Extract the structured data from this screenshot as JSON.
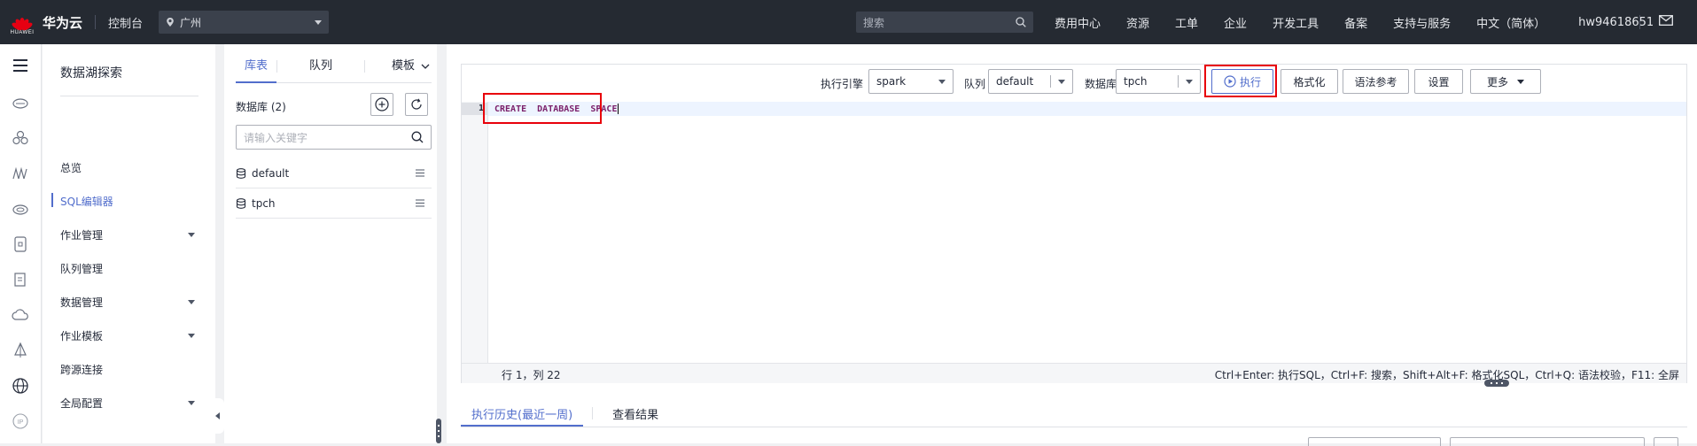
{
  "topbar": {
    "logo_text": "HUAWEI",
    "brand": "华为云",
    "console": "控制台",
    "region": "广州",
    "search_placeholder": "搜索",
    "nav": [
      "费用中心",
      "资源",
      "工单",
      "企业",
      "开发工具",
      "备案",
      "支持与服务",
      "中文（简体）"
    ],
    "user": "hw94618651"
  },
  "service": {
    "title": "数据湖探索",
    "menu": [
      {
        "label": "总览",
        "has_arrow": false,
        "active": false
      },
      {
        "label": "SQL编辑器",
        "has_arrow": false,
        "active": true
      },
      {
        "label": "作业管理",
        "has_arrow": true,
        "active": false
      },
      {
        "label": "队列管理",
        "has_arrow": false,
        "active": false
      },
      {
        "label": "数据管理",
        "has_arrow": true,
        "active": false
      },
      {
        "label": "作业模板",
        "has_arrow": true,
        "active": false
      },
      {
        "label": "跨源连接",
        "has_arrow": false,
        "active": false
      },
      {
        "label": "全局配置",
        "has_arrow": true,
        "active": false
      }
    ]
  },
  "db_panel": {
    "tabs": [
      "库表",
      "队列",
      "模板"
    ],
    "count_label": "数据库 (2)",
    "search_placeholder": "请输入关键字",
    "databases": [
      "default",
      "tpch"
    ]
  },
  "editor": {
    "engine_label": "执行引擎",
    "engine_value": "spark",
    "queue_label": "队列",
    "queue_value": "default",
    "db_label": "数据库",
    "db_value": "tpch",
    "buttons": {
      "execute": "执行",
      "format": "格式化",
      "syntax": "语法参考",
      "settings": "设置",
      "more": "更多"
    },
    "line_number": "1",
    "code": "CREATE  DATABASE  SPACE",
    "status_pos": "行 1，列 22",
    "shortcuts": "Ctrl+Enter: 执行SQL，Ctrl+F: 搜索，Shift+Alt+F: 格式化SQL，Ctrl+Q: 语法校验，F11: 全屏"
  },
  "bottom_tabs": [
    "执行历史(最近一周)",
    "查看结果"
  ],
  "colors": {
    "accent": "#526ecc",
    "highlight_box": "#e8000b",
    "topbar_bg": "#252a32",
    "sql_keyword": "#7a1f6a"
  }
}
